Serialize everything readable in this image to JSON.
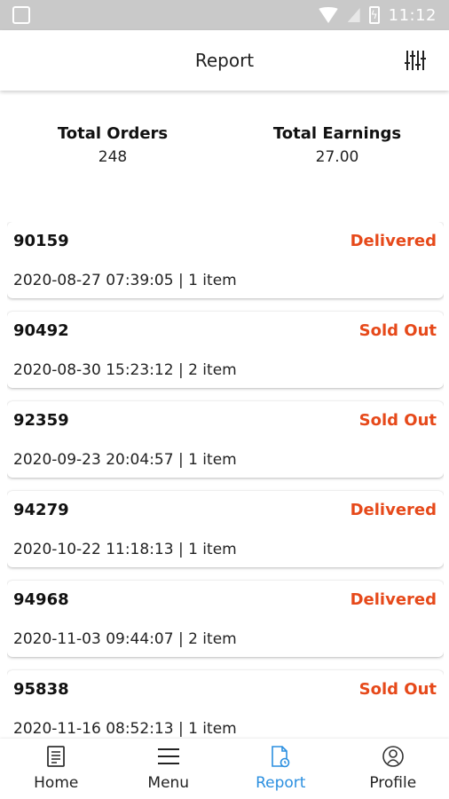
{
  "status_bar": {
    "time": "11:12"
  },
  "app_bar": {
    "title": "Report"
  },
  "stats": {
    "orders_label": "Total Orders",
    "orders_value": "248",
    "earnings_label": "Total Earnings",
    "earnings_value": "27.00"
  },
  "orders": [
    {
      "id": "90159",
      "status": "Delivered",
      "meta": "2020-08-27 07:39:05 | 1 item"
    },
    {
      "id": "90492",
      "status": "Sold Out",
      "meta": "2020-08-30 15:23:12 | 2 item"
    },
    {
      "id": "92359",
      "status": "Sold Out",
      "meta": "2020-09-23 20:04:57 | 1 item"
    },
    {
      "id": "94279",
      "status": "Delivered",
      "meta": "2020-10-22 11:18:13 | 1 item"
    },
    {
      "id": "94968",
      "status": "Delivered",
      "meta": "2020-11-03 09:44:07 | 2 item"
    },
    {
      "id": "95838",
      "status": "Sold Out",
      "meta": "2020-11-16 08:52:13 | 1 item"
    }
  ],
  "bottom_nav": {
    "home": "Home",
    "menu": "Menu",
    "report": "Report",
    "profile": "Profile"
  },
  "colors": {
    "status_accent": "#e6491a",
    "active_tab": "#2b8fe0"
  },
  "icons": {
    "filter": "sliders-icon",
    "home": "document-list-icon",
    "menu": "hamburger-icon",
    "report": "report-icon",
    "profile": "profile-icon"
  }
}
